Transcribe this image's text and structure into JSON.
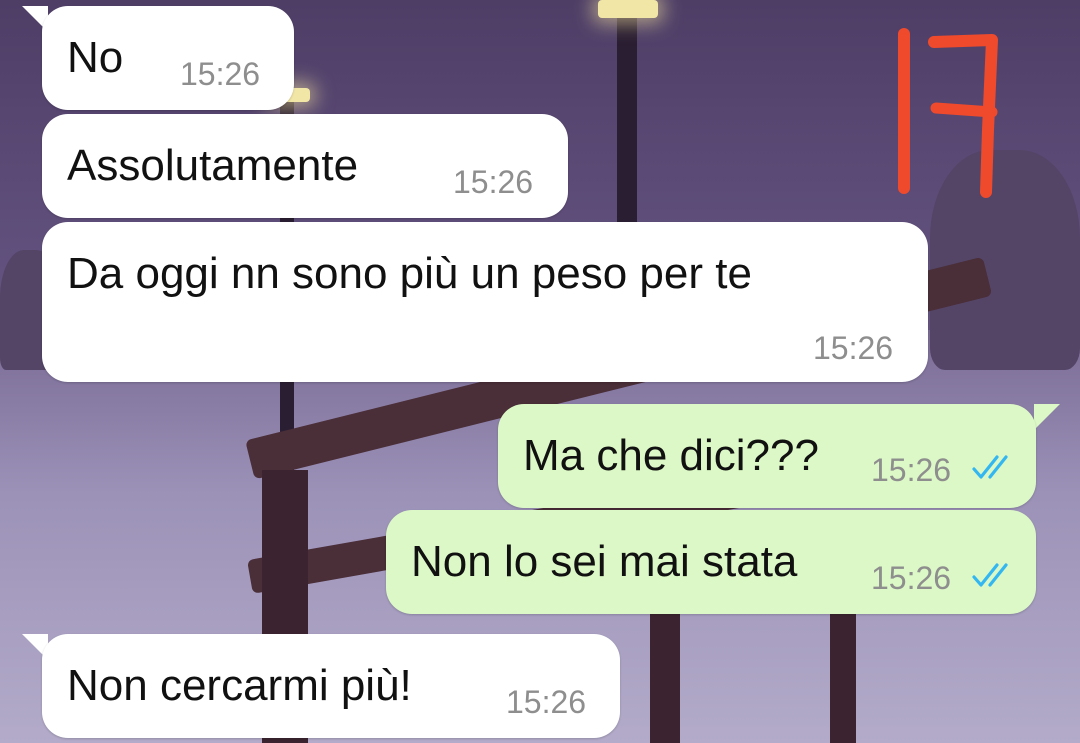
{
  "theme": {
    "incoming_bubble": "#ffffff",
    "outgoing_bubble": "#dcf8c6",
    "text_color": "#111111",
    "time_color": "#8e8e8e",
    "read_tick_color": "#34b7f1",
    "sticker_color": "#ef4a2c"
  },
  "sticker": {
    "text": "17"
  },
  "messages": [
    {
      "direction": "incoming",
      "text": "No",
      "time": "15:26"
    },
    {
      "direction": "incoming",
      "text": "Assolutamente",
      "time": "15:26"
    },
    {
      "direction": "incoming",
      "text": "Da oggi nn sono più un peso per te",
      "time": "15:26"
    },
    {
      "direction": "outgoing",
      "text": "Ma che dici???",
      "time": "15:26",
      "status": "read"
    },
    {
      "direction": "outgoing",
      "text": "Non lo sei mai stata",
      "time": "15:26",
      "status": "read"
    },
    {
      "direction": "incoming",
      "text": "Non cercarmi più!",
      "time": "15:26"
    }
  ],
  "icons": {
    "read_status": "double-check-icon"
  }
}
